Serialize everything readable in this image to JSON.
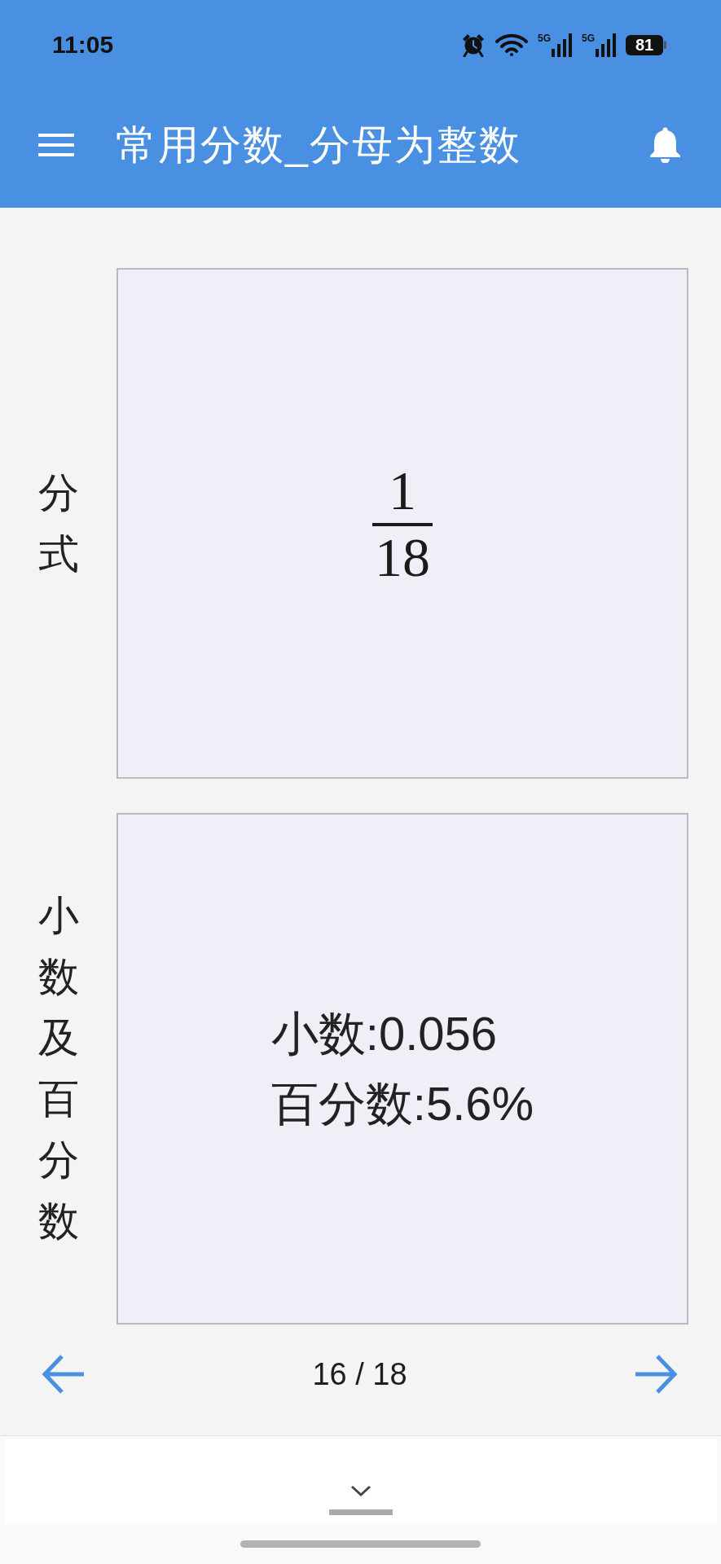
{
  "status_bar": {
    "time": "11:05",
    "network": [
      {
        "label": "5G"
      },
      {
        "label": "5G"
      }
    ],
    "battery": "81"
  },
  "app_bar": {
    "title": "常用分数_分母为整数"
  },
  "cards": [
    {
      "kind": "fraction",
      "label": "分式",
      "numerator": "1",
      "denominator": "18"
    },
    {
      "kind": "lines",
      "label": "小数及百分数",
      "lines": [
        "小数:0.056",
        "百分数:5.6%"
      ]
    }
  ],
  "pager": {
    "position": "16 / 18"
  }
}
